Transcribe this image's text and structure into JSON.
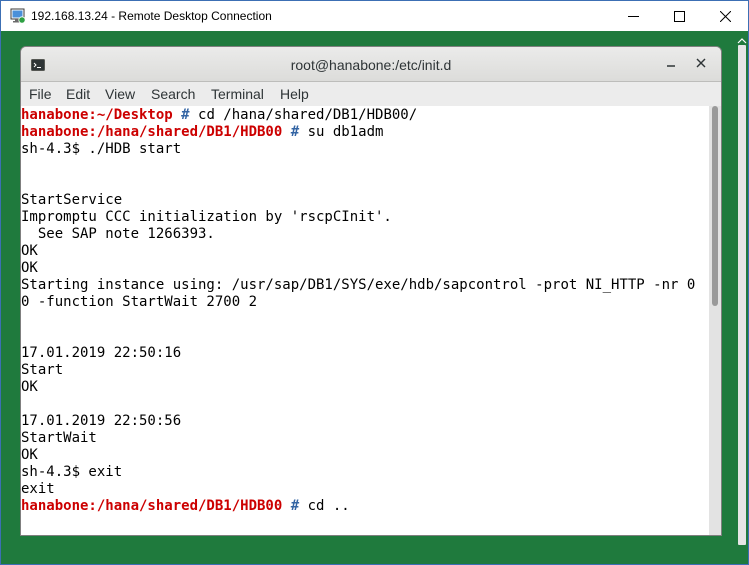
{
  "rdp": {
    "title": "192.168.13.24 - Remote Desktop Connection",
    "icons": {
      "app": "remote-desktop-icon",
      "minimize": "minimize-icon",
      "maximize": "maximize-icon",
      "close": "close-icon"
    },
    "colors": {
      "desktop": "#1f7a3d",
      "frame_border": "#3c6fb4"
    }
  },
  "terminal": {
    "title": "root@hanabone:/etc/init.d",
    "icons": {
      "app": "terminal-icon",
      "minimize": "minimize-icon",
      "close": "close-icon"
    },
    "menu": [
      "File",
      "Edit",
      "View",
      "Search",
      "Terminal",
      "Help"
    ],
    "colors": {
      "prompt": "#cc0000",
      "hash": "#3465a4"
    },
    "lines": [
      {
        "prompt": "hanabone:~/Desktop",
        "hash": " # ",
        "text": "cd /hana/shared/DB1/HDB00/"
      },
      {
        "prompt": "hanabone:/hana/shared/DB1/HDB00",
        "hash": " # ",
        "text": "su db1adm"
      },
      {
        "text": "sh-4.3$ ./HDB start"
      },
      {
        "text": ""
      },
      {
        "text": ""
      },
      {
        "text": "StartService"
      },
      {
        "text": "Impromptu CCC initialization by 'rscpCInit'."
      },
      {
        "text": "  See SAP note 1266393."
      },
      {
        "text": "OK"
      },
      {
        "text": "OK"
      },
      {
        "text": "Starting instance using: /usr/sap/DB1/SYS/exe/hdb/sapcontrol -prot NI_HTTP -nr 0"
      },
      {
        "text": "0 -function StartWait 2700 2"
      },
      {
        "text": ""
      },
      {
        "text": ""
      },
      {
        "text": "17.01.2019 22:50:16"
      },
      {
        "text": "Start"
      },
      {
        "text": "OK"
      },
      {
        "text": ""
      },
      {
        "text": "17.01.2019 22:50:56"
      },
      {
        "text": "StartWait"
      },
      {
        "text": "OK"
      },
      {
        "text": "sh-4.3$ exit"
      },
      {
        "text": "exit"
      },
      {
        "prompt": "hanabone:/hana/shared/DB1/HDB00",
        "hash": " # ",
        "text": "cd .."
      }
    ]
  }
}
